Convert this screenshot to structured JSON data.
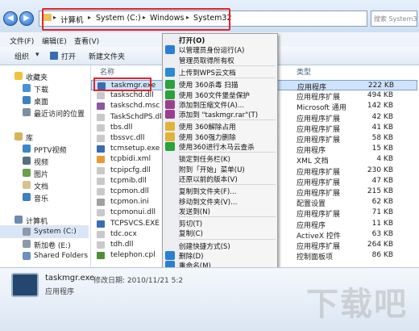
{
  "address": {
    "crumbs": [
      "计算机",
      "System (C:)",
      "Windows",
      "System32"
    ],
    "search_placeholder": "搜索 System32"
  },
  "menubar": [
    "文件(F)",
    "编辑(E)",
    "查看(V)"
  ],
  "toolbar": {
    "organize": "组织",
    "open": "打开",
    "new_folder": "新建文件夹"
  },
  "nav": {
    "favorites": "收藏夹",
    "favorites_items": [
      "下载",
      "桌面",
      "最近访问的位置"
    ],
    "libraries": "库",
    "library_items": [
      "PPTV视频",
      "视频",
      "图片",
      "文档",
      "音乐"
    ],
    "computer": "计算机",
    "computer_items": [
      "System (C:)",
      "新加卷 (E:)",
      "Shared Folders"
    ]
  },
  "columns": {
    "name": "名称",
    "type": "类型"
  },
  "files": [
    {
      "name": "taskmgr.exe",
      "frag": "",
      "type": "应用程序",
      "size": "222 KB",
      "color": "#3a6db0",
      "selected": true
    },
    {
      "name": "taskschd.dll",
      "frag": "9",
      "type": "应用程序扩展",
      "size": "494 KB",
      "color": "#c9c9c9"
    },
    {
      "name": "taskschd.msc",
      "frag": "",
      "type": "Microsoft 通用",
      "size": "142 KB",
      "color": "#8b5a9e"
    },
    {
      "name": "TaskSchdPS.dll",
      "frag": "9",
      "type": "应用程序扩展",
      "size": "42 KB",
      "color": "#c9c9c9"
    },
    {
      "name": "tbs.dll",
      "frag": "9",
      "type": "应用程序扩展",
      "size": "41 KB",
      "color": "#c9c9c9"
    },
    {
      "name": "tbssvc.dll",
      "frag": "9",
      "type": "应用程序扩展",
      "size": "58 KB",
      "color": "#c9c9c9"
    },
    {
      "name": "tcmsetup.exe",
      "frag": "",
      "type": "应用程序",
      "size": "15 KB",
      "color": "#3a6db0"
    },
    {
      "name": "tcpbidi.xml",
      "frag": "",
      "type": "XML 文档",
      "size": "4 KB",
      "color": "#e79b38"
    },
    {
      "name": "tcpipcfg.dll",
      "frag": "",
      "type": "应用程序扩展",
      "size": "230 KB",
      "color": "#c9c9c9"
    },
    {
      "name": "tcpmib.dll",
      "frag": "",
      "type": "应用程序扩展",
      "size": "47 KB",
      "color": "#c9c9c9"
    },
    {
      "name": "tcpmon.dll",
      "frag": "",
      "type": "应用程序扩展",
      "size": "215 KB",
      "color": "#c9c9c9"
    },
    {
      "name": "tcpmon.ini",
      "frag": "",
      "type": "配置设置",
      "size": "62 KB",
      "color": "#a0a0a0"
    },
    {
      "name": "tcpmonui.dll",
      "frag": "",
      "type": "应用程序扩展",
      "size": "71 KB",
      "color": "#c9c9c9"
    },
    {
      "name": "TCPSVCS.EXE",
      "frag": "",
      "type": "应用程序",
      "size": "11 KB",
      "color": "#3a6db0"
    },
    {
      "name": "tdc.ocx",
      "frag": "",
      "type": "ActiveX 控件",
      "size": "63 KB",
      "color": "#c9c9c9"
    },
    {
      "name": "tdh.dll",
      "frag": "",
      "type": "应用程序扩展",
      "size": "264 KB",
      "color": "#c9c9c9"
    },
    {
      "name": "telephon.cpl",
      "frag": "",
      "type": "控制面板项",
      "size": "86 KB",
      "color": "#4f8f3a"
    }
  ],
  "context_menu": [
    {
      "label": "打开(O)",
      "bold": true,
      "icon": "",
      "color": ""
    },
    {
      "label": "以管理员身份运行(A)",
      "icon": "shield-icon",
      "color": "#2a7fd4"
    },
    {
      "label": "管理员取得所有权",
      "icon": "",
      "color": ""
    },
    {
      "sep": true
    },
    {
      "label": "上传到WPS云文档",
      "icon": "cloud-icon",
      "color": "#2a8ad4"
    },
    {
      "sep": true
    },
    {
      "label": "使用 360杀毒 扫描",
      "icon": "shield-360-icon",
      "color": "#2aa33a"
    },
    {
      "label": "使用 360文件堡垒保护",
      "icon": "shield-360-icon",
      "color": "#2aa33a"
    },
    {
      "label": "添加到压缩文件(A)...",
      "icon": "archive-icon",
      "color": "#9a3f8f"
    },
    {
      "label": "添加到 \"taskmgr.rar\"(T)",
      "icon": "archive-icon",
      "color": "#9a3f8f"
    },
    {
      "sep": true
    },
    {
      "label": "使用 360解除占用",
      "icon": "folder-360-icon",
      "color": "#e3b23a"
    },
    {
      "label": "使用 360强力删除",
      "icon": "trash-360-icon",
      "color": "#e3b23a"
    },
    {
      "label": "使用360进行木马云查杀",
      "icon": "cloud-scan-icon",
      "color": "#2aa33a"
    },
    {
      "sep": true
    },
    {
      "label": "锁定到任务栏(K)",
      "icon": "",
      "color": ""
    },
    {
      "label": "附到「开始」菜单(U)",
      "icon": "",
      "color": ""
    },
    {
      "label": "还原以前的版本(V)",
      "icon": "",
      "color": ""
    },
    {
      "sep": true
    },
    {
      "label": "复制到文件夹(F)...",
      "icon": "",
      "color": ""
    },
    {
      "label": "移动到文件夹(V)...",
      "icon": "",
      "color": ""
    },
    {
      "label": "发送到(N)",
      "icon": "",
      "color": ""
    },
    {
      "sep": true
    },
    {
      "label": "剪切(T)",
      "icon": "",
      "color": ""
    },
    {
      "label": "复制(C)",
      "icon": "",
      "color": ""
    },
    {
      "sep": true
    },
    {
      "label": "创建快捷方式(S)",
      "icon": "",
      "color": ""
    },
    {
      "label": "删除(D)",
      "icon": "shield-icon",
      "color": "#2a7fd4"
    },
    {
      "label": "重命名(M)",
      "icon": "shield-icon",
      "color": "#2a7fd4"
    },
    {
      "sep": true
    },
    {
      "label": "属性(R)",
      "icon": "",
      "color": ""
    }
  ],
  "details": {
    "filename": "taskmgr.exe",
    "modified": "修改日期: 2010/11/21 5:2",
    "type": "应用程序"
  },
  "watermark": "下载吧"
}
